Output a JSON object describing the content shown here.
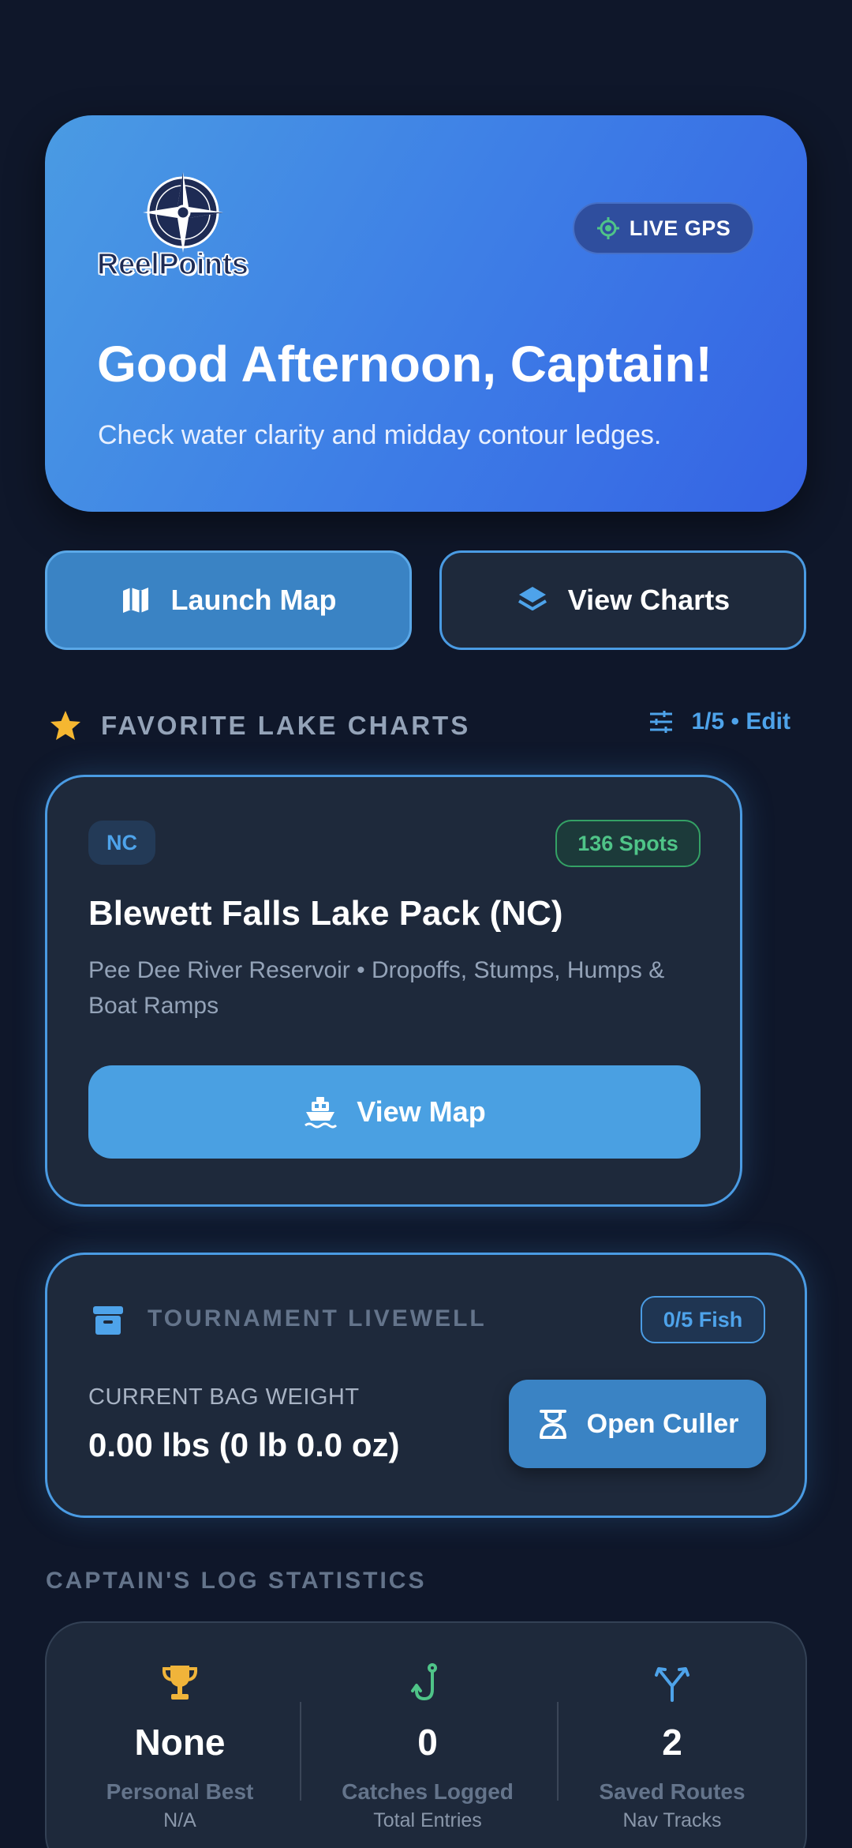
{
  "hero": {
    "brand": "ReelPoints",
    "gps_label": "LIVE GPS",
    "greeting": "Good Afternoon, Captain!",
    "tip": "Check water clarity and midday contour ledges."
  },
  "actions": {
    "launch_map": "Launch Map",
    "view_charts": "View Charts"
  },
  "favorites": {
    "title": "FAVORITE LAKE CHARTS",
    "count_edit": "1/5 • Edit",
    "card": {
      "state": "NC",
      "spots": "136 Spots",
      "title": "Blewett Falls Lake Pack (NC)",
      "description": "Pee Dee River Reservoir • Dropoffs, Stumps, Humps & Boat Ramps",
      "button": "View Map"
    }
  },
  "livewell": {
    "title": "TOURNAMENT LIVEWELL",
    "fish_count": "0/5 Fish",
    "bag_label": "CURRENT BAG WEIGHT",
    "bag_value": "0.00 lbs (0 lb 0.0 oz)",
    "culler_button": "Open Culler"
  },
  "stats": {
    "heading": "CAPTAIN'S LOG STATISTICS",
    "items": [
      {
        "value": "None",
        "label": "Personal Best",
        "sub": "N/A",
        "icon": "trophy-icon"
      },
      {
        "value": "0",
        "label": "Catches Logged",
        "sub": "Total Entries",
        "icon": "fish-hook-icon"
      },
      {
        "value": "2",
        "label": "Saved Routes",
        "sub": "Nav Tracks",
        "icon": "route-split-icon"
      }
    ]
  },
  "colors": {
    "background": "#0f172a",
    "card": "#1e293b",
    "accent_blue": "#4a9be3",
    "success_green": "#4fc488",
    "trophy_gold": "#f0b43a"
  }
}
